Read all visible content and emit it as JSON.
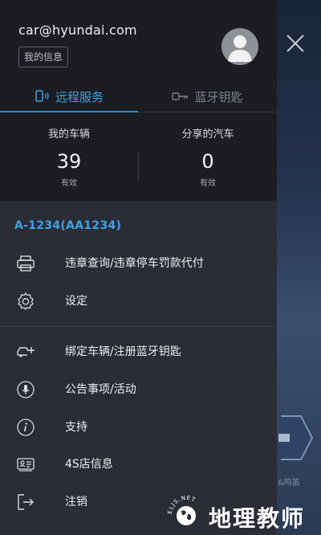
{
  "account": {
    "email": "car@hyundai.com",
    "my_info_label": "我的信息"
  },
  "tabs": [
    {
      "label": "远程服务",
      "icon": "phone-signal-icon",
      "active": true
    },
    {
      "label": "蓝牙钥匙",
      "icon": "key-icon",
      "active": false
    }
  ],
  "stats": {
    "my_vehicles": {
      "label": "我的车辆",
      "value": "39",
      "sub": "有效"
    },
    "shared": {
      "label": "分享的汽车",
      "value": "0",
      "sub": "有效"
    }
  },
  "vehicle_id": "A-1234(AA1234)",
  "menu": {
    "violations": "违章查询/违章停车罚款代付",
    "settings": "设定",
    "bind_vehicle": "绑定车辆/注册蓝牙钥匙",
    "announcements": "公告事项/活动",
    "support": "支持",
    "dealer_info": "4S店信息",
    "logout": "注销"
  },
  "background": {
    "label_partial": "&鸣笛"
  },
  "watermark": {
    "text": "地理教师",
    "ring_text": "ELJS.NET"
  },
  "colors": {
    "accent": "#3fa2e4",
    "drawer_bg": "#2a2d35",
    "header_bg": "#1b1d22"
  }
}
